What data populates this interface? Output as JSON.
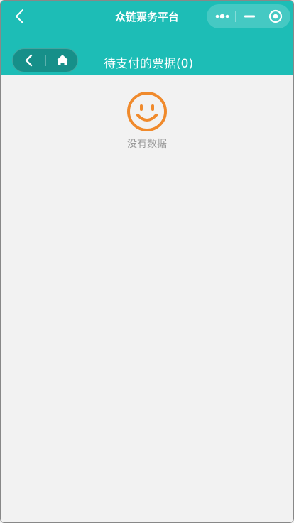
{
  "navbar": {
    "title": "众链票务平台",
    "back_icon": "chevron-left-icon",
    "menu_icon": "more-dots-icon",
    "minimize_icon": "minus-icon",
    "close_icon": "target-circle-icon",
    "background": "#1dbdb6"
  },
  "header": {
    "title": "待支付的票据(0)",
    "back_icon": "chevron-left-icon",
    "home_icon": "home-icon",
    "background": "#1dbdb6"
  },
  "empty_state": {
    "icon": "smile-face-icon",
    "icon_color": "#f08a2c",
    "text": "没有数据"
  }
}
